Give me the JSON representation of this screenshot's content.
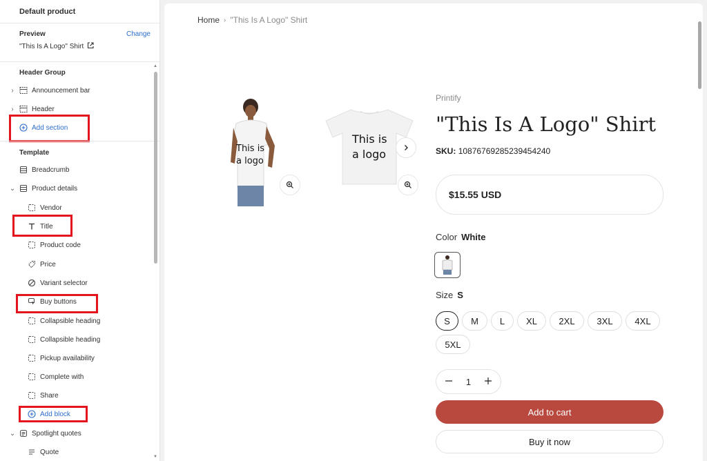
{
  "sidebar": {
    "title": "Default product",
    "preview_label": "Preview",
    "preview_change": "Change",
    "preview_value": "\"This Is A Logo\" Shirt",
    "header_group": {
      "label": "Header Group",
      "items": [
        {
          "label": "Announcement bar"
        },
        {
          "label": "Header"
        }
      ],
      "add_section": "Add section"
    },
    "template": {
      "label": "Template",
      "breadcrumb": "Breadcrumb",
      "product_details": "Product details",
      "blocks": [
        {
          "label": "Vendor",
          "icon": "dashed-square-icon"
        },
        {
          "label": "Title",
          "icon": "text-icon"
        },
        {
          "label": "Product code",
          "icon": "dashed-square-icon"
        },
        {
          "label": "Price",
          "icon": "price-tag-icon"
        },
        {
          "label": "Variant selector",
          "icon": "variant-icon"
        },
        {
          "label": "Buy buttons",
          "icon": "cursor-button-icon"
        },
        {
          "label": "Collapsible heading",
          "icon": "dashed-square-icon"
        },
        {
          "label": "Collapsible heading",
          "icon": "dashed-square-icon"
        },
        {
          "label": "Pickup availability",
          "icon": "dashed-square-icon"
        },
        {
          "label": "Complete with",
          "icon": "dashed-square-icon"
        },
        {
          "label": "Share",
          "icon": "dashed-square-icon"
        }
      ],
      "add_block": "Add block",
      "spotlight": "Spotlight quotes",
      "quote": "Quote"
    }
  },
  "preview": {
    "breadcrumb": {
      "home": "Home",
      "current": "\"This Is A Logo\" Shirt"
    },
    "product": {
      "vendor": "Printify",
      "title": "\"This Is A Logo\" Shirt",
      "sku_label": "SKU:",
      "sku_value": "10876769285239454240",
      "price": "$15.55 USD",
      "color_label": "Color",
      "color_value": "White",
      "size_label": "Size",
      "size_value": "S",
      "sizes": [
        "S",
        "M",
        "L",
        "XL",
        "2XL",
        "3XL",
        "4XL",
        "5XL"
      ],
      "quantity": "1",
      "add_to_cart": "Add to cart",
      "buy_now": "Buy it now",
      "shirt_text_1": "This is",
      "shirt_text_2": "a logo"
    }
  },
  "colors": {
    "accent_link": "#2c6ecb",
    "add_to_cart_bg": "#b9483e",
    "highlight_box": "#e3141d"
  }
}
